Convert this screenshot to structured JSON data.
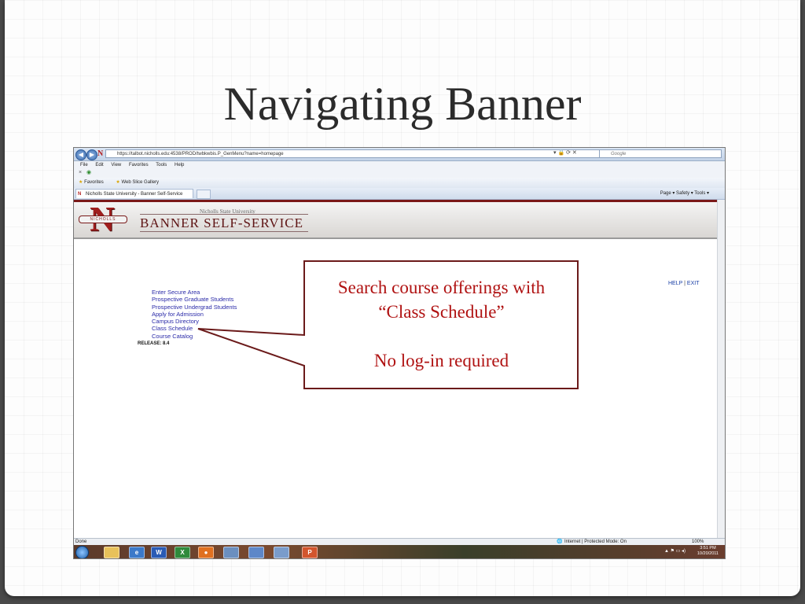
{
  "slide": {
    "title": "Navigating Banner"
  },
  "browser": {
    "url": "https://talbot.nicholls.edu:4538/PROD/twbkwbis.P_GenMenu?name=homepage",
    "search_placeholder": "Google",
    "menu": [
      "File",
      "Edit",
      "View",
      "Favorites",
      "Tools",
      "Help"
    ],
    "favorites_label": "Favorites",
    "web_slice_label": "Web Slice Gallery",
    "tab_title": "Nicholls State University - Banner Self-Service",
    "tab_tools": "Page ▾  Safety ▾  Tools ▾",
    "status_left": "Done",
    "status_zone": "Internet | Protected Mode: On",
    "zoom": "100%"
  },
  "page": {
    "university": "Nicholls State University",
    "logo_band": "NICHOLLS",
    "logo_letter": "N",
    "title": "BANNER SELF-SERVICE",
    "help": "HELP",
    "sep": "|",
    "exit": "EXIT",
    "links": [
      "Enter Secure Area",
      "Prospective Graduate Students",
      "Prospective Undergrad Students",
      "Apply for Admission",
      "Campus Directory",
      "Class Schedule",
      "Course Catalog"
    ],
    "release": "RELEASE: 8.4"
  },
  "taskbar": {
    "time": "3:51 PM",
    "date": "10/20/2011"
  },
  "callout": {
    "line1": "Search course offerings with",
    "line2": "“Class Schedule”",
    "line3": "No log-in required"
  },
  "colors": {
    "callout_text": "#b01212",
    "callout_border": "#6b1a1a",
    "brand": "#a01d1d",
    "link": "#2a2aa8"
  }
}
